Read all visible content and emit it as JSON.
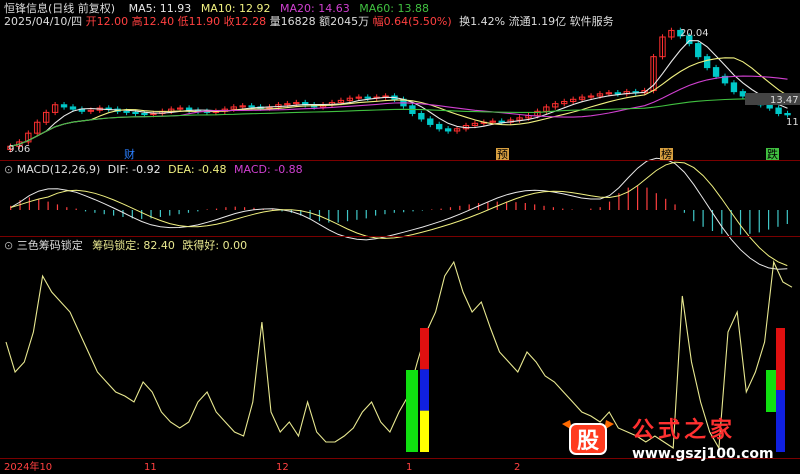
{
  "header": {
    "stock_name": "恒锋信息(日线 前复权)",
    "ma5": "MA5: 11.93",
    "ma10": "MA10: 12.92",
    "ma20": "MA20: 14.63",
    "ma60": "MA60: 13.88",
    "date": "2025/04/10/四",
    "open": "开12.00",
    "high": "高12.40",
    "low": "低11.90",
    "close": "收12.28",
    "volume": "量16828",
    "amount": "额2045万",
    "change": "幅0.64(5.50%)",
    "turnover": "换1.42%",
    "float_cap": "流通1.19亿",
    "sector": "软件服务"
  },
  "price_annotations": {
    "peak": "20.04",
    "trough": "9.06",
    "last_level": "13.47",
    "last_low": "11"
  },
  "event_markers": [
    "财",
    "预",
    "榜",
    "跌"
  ],
  "macd_header": {
    "name": "MACD(12,26,9)",
    "dif": "DIF: -0.92",
    "dea": "DEA: -0.48",
    "macd": "MACD: -0.88"
  },
  "indicator_header": {
    "name": "三色筹码锁定",
    "lock": "筹码锁定: 82.40",
    "good": "跌得好: 0.00"
  },
  "time_axis": [
    "2024年10",
    "11",
    "12",
    "1",
    "2"
  ],
  "watermark": {
    "text": "公式之家",
    "url": "www.gszj100.com"
  },
  "colors": {
    "background": "#000000",
    "ma5": "#e8e8e8",
    "ma10": "#f0f080",
    "ma20": "#d040d0",
    "ma60": "#40c040",
    "up": "#ff3030",
    "down": "#00c8c8",
    "indicator": "#e8e890"
  },
  "chart_data": [
    {
      "type": "candlestick",
      "title": "恒锋信息(日线 前复权)",
      "close": [
        9.4,
        9.8,
        10.6,
        11.6,
        12.5,
        13.2,
        13.0,
        12.8,
        12.6,
        12.7,
        12.9,
        12.8,
        12.6,
        12.5,
        12.4,
        12.3,
        12.4,
        12.6,
        12.8,
        12.9,
        12.7,
        12.6,
        12.5,
        12.6,
        12.8,
        13.0,
        13.1,
        13.0,
        12.9,
        13.0,
        13.2,
        13.3,
        13.4,
        13.2,
        13.0,
        13.2,
        13.4,
        13.6,
        13.8,
        13.9,
        13.8,
        13.9,
        14.0,
        13.7,
        13.1,
        12.4,
        11.9,
        11.4,
        11.0,
        10.8,
        11.0,
        11.3,
        11.5,
        11.6,
        11.7,
        11.6,
        11.8,
        12.0,
        12.2,
        12.6,
        13.0,
        13.3,
        13.5,
        13.7,
        13.9,
        14.0,
        14.2,
        14.3,
        14.2,
        14.4,
        14.3,
        14.5,
        17.6,
        19.4,
        20.0,
        19.5,
        18.8,
        17.6,
        16.6,
        15.8,
        15.2,
        14.4,
        14.0,
        13.6,
        13.2,
        12.9,
        12.4,
        12.28
      ],
      "ylim": [
        9.06,
        20.04
      ],
      "annotations": [
        "20.04",
        "9.06",
        "13.47"
      ],
      "moving_averages": [
        "MA5: 11.93",
        "MA10: 12.92",
        "MA20: 14.63",
        "MA60: 13.88"
      ]
    },
    {
      "type": "bar",
      "title": "MACD(12,26,9)",
      "dif": -0.92,
      "dea": -0.48,
      "macd": -0.88,
      "histogram": [
        0.15,
        0.35,
        0.45,
        0.4,
        0.3,
        0.2,
        0.1,
        0.05,
        -0.05,
        -0.1,
        -0.15,
        -0.2,
        -0.25,
        -0.3,
        -0.32,
        -0.3,
        -0.25,
        -0.2,
        -0.15,
        -0.1,
        -0.05,
        0.02,
        0.05,
        0.1,
        0.12,
        0.1,
        0.08,
        0.05,
        0.02,
        -0.05,
        -0.1,
        -0.2,
        -0.3,
        -0.4,
        -0.45,
        -0.45,
        -0.4,
        -0.35,
        -0.3,
        -0.2,
        -0.15,
        -0.1,
        -0.08,
        -0.05,
        -0.02,
        0.02,
        0.05,
        0.1,
        0.15,
        0.2,
        0.25,
        0.28,
        0.3,
        0.3,
        0.28,
        0.25,
        0.2,
        0.15,
        0.1,
        0.05,
        0.02,
        0.0,
        0.05,
        0.1,
        0.3,
        0.6,
        0.8,
        0.85,
        0.8,
        0.6,
        0.4,
        0.2,
        -0.1,
        -0.4,
        -0.6,
        -0.75,
        -0.85,
        -0.9,
        -0.88,
        -0.85,
        -0.8,
        -0.7,
        -0.6,
        -0.5
      ]
    },
    {
      "type": "line",
      "title": "三色筹码锁定",
      "series": [
        {
          "name": "筹码锁定",
          "values": [
            55,
            40,
            45,
            60,
            88,
            80,
            75,
            70,
            60,
            50,
            40,
            35,
            30,
            28,
            25,
            35,
            30,
            20,
            15,
            12,
            15,
            25,
            30,
            20,
            15,
            10,
            8,
            25,
            65,
            20,
            10,
            15,
            8,
            25,
            10,
            5,
            5,
            8,
            12,
            20,
            25,
            15,
            10,
            20,
            28,
            45,
            60,
            70,
            88,
            95,
            80,
            70,
            75,
            62,
            50,
            45,
            40,
            50,
            45,
            38,
            35,
            30,
            25,
            20,
            18,
            15,
            20,
            12,
            10,
            8,
            5,
            8,
            5,
            2,
            78,
            45,
            25,
            10,
            2,
            60,
            70,
            30,
            40,
            55,
            95,
            85,
            82.4
          ]
        }
      ],
      "bars": [
        {
          "position": "second-half",
          "segments": [
            "red",
            "blue",
            "yellow",
            "green"
          ]
        },
        {
          "position": "end",
          "segments": [
            "red",
            "blue",
            "green"
          ]
        }
      ],
      "ylim": [
        0,
        100
      ]
    }
  ]
}
